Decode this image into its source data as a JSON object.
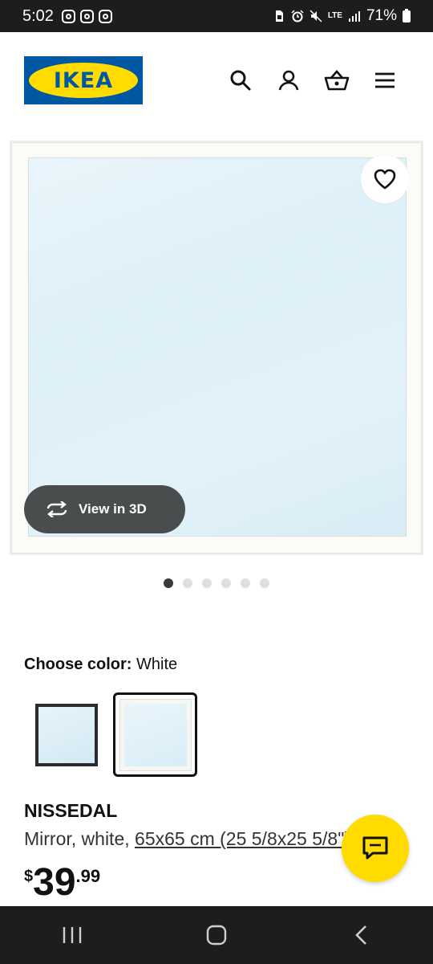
{
  "status_bar": {
    "time": "5:02",
    "battery": "71%",
    "network": "LTE",
    "icons": [
      "instagram-icon",
      "instagram-icon",
      "instagram-icon",
      "sim-icon",
      "alarm-icon",
      "mute-icon",
      "lte-icon",
      "signal-icon",
      "battery-icon"
    ]
  },
  "header": {
    "logo_text": "IKEA",
    "icons": [
      "search-icon",
      "account-icon",
      "basket-icon",
      "menu-icon"
    ]
  },
  "gallery": {
    "view3d_label": "View in 3D",
    "dot_count": 6,
    "active_dot": 1
  },
  "color": {
    "label": "Choose color:",
    "value": "White",
    "swatches": [
      "black",
      "white"
    ],
    "selected": "white"
  },
  "product": {
    "name": "NISSEDAL",
    "desc_prefix": "Mirror, white, ",
    "desc_size": "65x65 cm (25 5/8x25 5/8\")",
    "price_currency": "$",
    "price_int": "39",
    "price_dec": ".99"
  },
  "colors": {
    "ikea_blue": "#0058a3",
    "ikea_yellow": "#ffdb00",
    "system_bar": "#1d1d1d"
  }
}
